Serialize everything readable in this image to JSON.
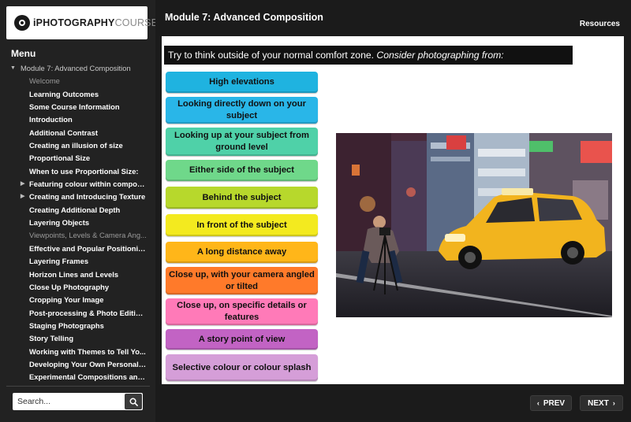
{
  "logo": {
    "bold": "iPHOTOGRAPHY",
    "light": "COURSE"
  },
  "header": {
    "module_title": "Module 7: Advanced Composition",
    "resources": "Resources"
  },
  "menu": {
    "title": "Menu",
    "module": "Module 7: Advanced Composition",
    "items": [
      {
        "label": "Welcome",
        "state": "dim"
      },
      {
        "label": "Learning Outcomes"
      },
      {
        "label": "Some Course Information"
      },
      {
        "label": "Introduction"
      },
      {
        "label": "Additional Contrast"
      },
      {
        "label": "Creating an illusion of size"
      },
      {
        "label": "Proportional Size"
      },
      {
        "label": "When to use Proportional Size:"
      },
      {
        "label": "Featuring colour within composit...",
        "expandable": true
      },
      {
        "label": "Creating and Introducing Texture",
        "expandable": true
      },
      {
        "label": "Creating Additional Depth"
      },
      {
        "label": "Layering Objects"
      },
      {
        "label": "Viewpoints, Levels & Camera Ang...",
        "state": "dim"
      },
      {
        "label": "Effective and Popular Positioning"
      },
      {
        "label": "Layering Frames"
      },
      {
        "label": "Horizon Lines and Levels"
      },
      {
        "label": "Close Up Photography"
      },
      {
        "label": "Cropping Your Image"
      },
      {
        "label": "Post-processing & Photo Editing S..."
      },
      {
        "label": "Staging Photographs"
      },
      {
        "label": "Story Telling"
      },
      {
        "label": "Working with Themes to Tell Yo..."
      },
      {
        "label": "Developing Your Own Personal S..."
      },
      {
        "label": "Experimental Compositions and P..."
      }
    ]
  },
  "search": {
    "placeholder": "Search..."
  },
  "content": {
    "banner_normal": "Try to think outside of your normal comfort zone.",
    "banner_italic": "Consider photographing from:",
    "options": [
      {
        "label": "High elevations",
        "color": "#1fb3e0"
      },
      {
        "label": "Looking directly down on your subject",
        "color": "#29b6e8"
      },
      {
        "label": "Looking up at your subject from ground level",
        "color": "#4fd1a8"
      },
      {
        "label": "Either side of the subject",
        "color": "#6fd88a"
      },
      {
        "label": "Behind the subject",
        "color": "#b7d82c"
      },
      {
        "label": "In front of the subject",
        "color": "#f3ea1f"
      },
      {
        "label": "A long distance away",
        "color": "#ffb619"
      },
      {
        "label": "Close up, with your camera angled or tilted",
        "color": "#ff7a2a"
      },
      {
        "label": "Close up, on specific details or features",
        "color": "#ff7ab8"
      },
      {
        "label": "A story point of view",
        "color": "#c263c4"
      },
      {
        "label": "Selective colour or colour splash",
        "color": "#d59ed8"
      }
    ]
  },
  "nav": {
    "prev": "PREV",
    "next": "NEXT"
  }
}
